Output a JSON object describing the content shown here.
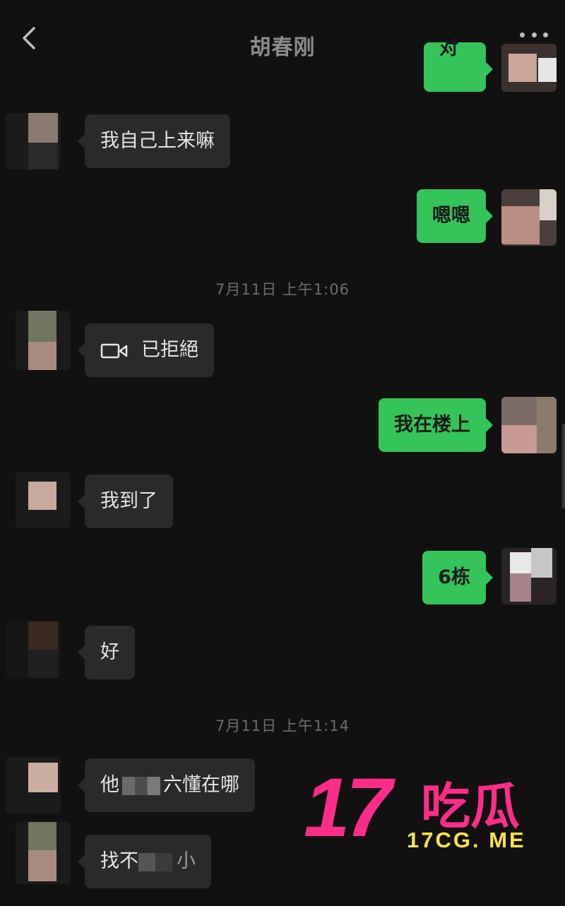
{
  "header": {
    "title": "胡春刚"
  },
  "messages": {
    "m0": "对",
    "m1": "我自己上来嘛",
    "m2": "嗯嗯",
    "ts1": "7月11日 上午1:06",
    "m3": "已拒絕",
    "m4": "我在楼上",
    "m5": "我到了",
    "m6": "6栋",
    "m7": "好",
    "ts2": "7月11日 上午1:14",
    "m8_a": "他",
    "m8_b": "六懂在哪",
    "m9_a": "找不",
    "m9_b": "小"
  },
  "watermark": {
    "num": "17",
    "cn": "吃瓜",
    "url": "17CG. ME"
  },
  "colors": {
    "bg": "#111111",
    "incoming": "#2a2a2a",
    "outgoing": "#34c45a",
    "brand": "#ff2c88",
    "url": "#ffe24a"
  }
}
